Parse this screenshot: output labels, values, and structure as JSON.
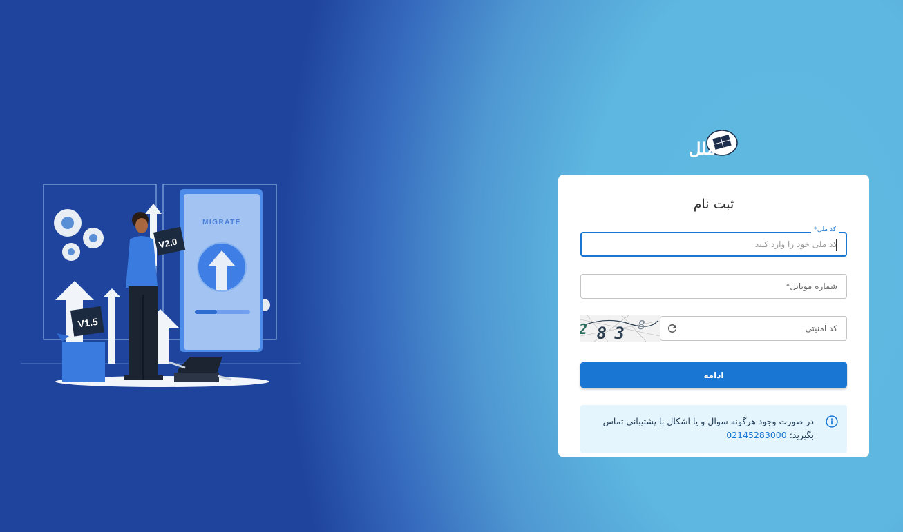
{
  "logo": {
    "text": "ملل"
  },
  "illustration": {
    "screen_heading": "MIGRATE",
    "chip_primary": "V2.0",
    "chip_secondary": "V1.5"
  },
  "form": {
    "title": "ثبت نام",
    "national_code": {
      "label": "کد ملی*",
      "placeholder": "کد ملی خود را وارد کنید",
      "value": ""
    },
    "mobile": {
      "label": "شماره موبایل*",
      "value": ""
    },
    "captcha": {
      "label": "کد امنیتی",
      "value": "",
      "image_digits": [
        "2",
        "8",
        "3",
        "8"
      ]
    },
    "submit_label": "ادامه"
  },
  "info": {
    "message": "در صورت وجود هرگونه سوال و یا اشکال با پشتیبانی تماس بگیرید:",
    "phone": "02145283000"
  },
  "colors": {
    "primary": "#1976d2",
    "info_bg": "#e5f5fd",
    "card_bg": "#ffffff"
  }
}
